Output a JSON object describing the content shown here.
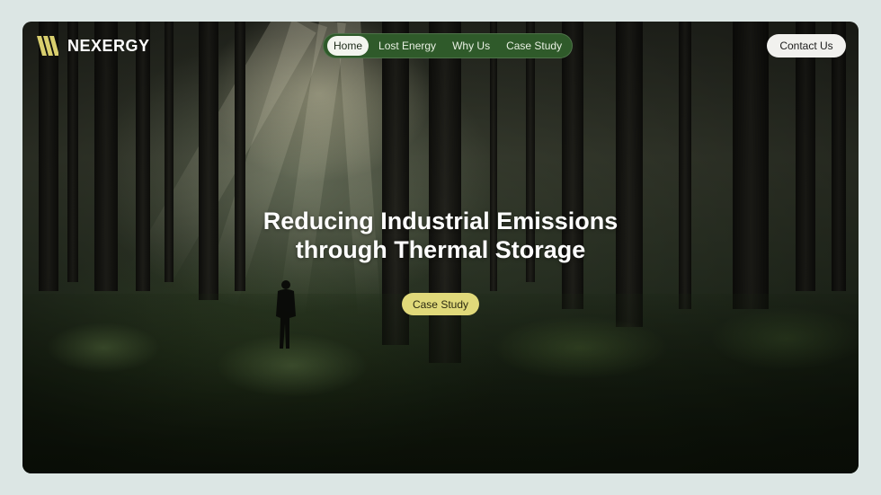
{
  "brand": {
    "name": "NEXERGY",
    "icon": "nexergy-stripes-logo-icon"
  },
  "nav": {
    "items": [
      {
        "label": "Home",
        "active": true
      },
      {
        "label": "Lost Energy",
        "active": false
      },
      {
        "label": "Why Us",
        "active": false
      },
      {
        "label": "Case Study",
        "active": false
      }
    ]
  },
  "header": {
    "contact_label": "Contact Us"
  },
  "hero": {
    "title_line1": "Reducing Industrial Emissions",
    "title_line2": "through Thermal Storage",
    "cta_label": "Case Study",
    "background": "forest-sunrays-photo"
  },
  "colors": {
    "page_bg": "#dce6e4",
    "nav_bg": "#2f5a2a",
    "cta_bg": "#e0d97a",
    "logo_accent": "#d9cf6e"
  }
}
